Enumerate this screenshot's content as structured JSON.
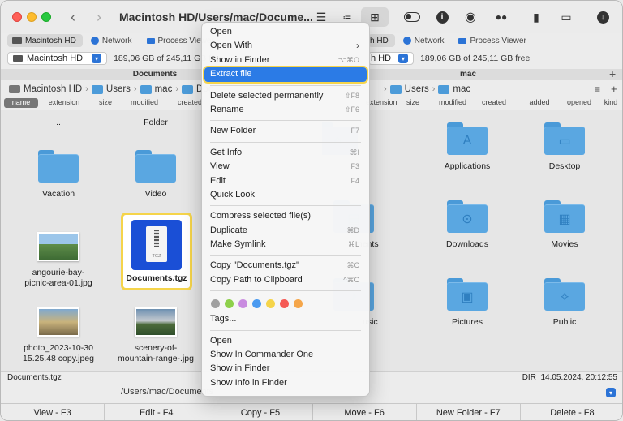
{
  "window": {
    "title": "Macintosh HD/Users/mac/Docume...",
    "traffic_lights": {
      "red": "#ff5f57",
      "yellow": "#febc2e",
      "green": "#28c840"
    }
  },
  "toolbar_icons": [
    "back-icon",
    "forward-icon",
    "list-icon",
    "detail-list-icon",
    "grid-icon",
    "toggle-icon",
    "info-icon",
    "eye-icon",
    "binoculars-icon",
    "zip-icon",
    "monitor-icon",
    "download-icon"
  ],
  "tabs_left": [
    {
      "label": "Macintosh HD",
      "icon": "hd-icon"
    },
    {
      "label": "Network",
      "icon": "globe-icon"
    },
    {
      "label": "Process Viewer",
      "icon": "process-icon"
    }
  ],
  "tabs_right": [
    {
      "label": "h HD",
      "icon": "hd-icon"
    },
    {
      "label": "Network",
      "icon": "globe-icon"
    },
    {
      "label": "Process Viewer",
      "icon": "process-icon"
    }
  ],
  "left_panel": {
    "drive": "Macintosh HD",
    "free": "189,06 GB of 245,11 GB free",
    "header": "Documents",
    "path": [
      "Macintosh HD",
      "Users",
      "mac",
      "Doc"
    ],
    "columns": [
      "name",
      "extension",
      "size",
      "modified",
      "created"
    ],
    "items": [
      {
        "name": "..",
        "kind": "up"
      },
      {
        "name": "Folder",
        "kind": "folder"
      },
      {
        "name": "Vacation",
        "kind": "folder"
      },
      {
        "name": "Video",
        "kind": "folder"
      },
      {
        "name": "angourie-bay-picnic-area-01.jpg",
        "kind": "photo"
      },
      {
        "name": "Documents.tgz",
        "kind": "archive",
        "badge": "TGZ"
      },
      {
        "name": "photo_2023-10-30 15.25.48 copy.jpeg",
        "kind": "photo"
      },
      {
        "name": "scenery-of-mountain-range-.jpg",
        "kind": "photo"
      }
    ]
  },
  "right_panel": {
    "drive": "h HD",
    "free": "189,06 GB of 245,11 GB free",
    "header": "mac",
    "path": [
      "Macintosh HD",
      "Users",
      "mac"
    ],
    "columns": [
      "extension",
      "size",
      "modified",
      "created",
      "added",
      "opened",
      "kind"
    ],
    "items": [
      {
        "name": "",
        "kind": "folder",
        "icon": "home-icon"
      },
      {
        "name": "Applications",
        "kind": "folder",
        "icon": "apps-icon"
      },
      {
        "name": "Desktop",
        "kind": "folder",
        "icon": "desktop-icon"
      },
      {
        "name": "ments",
        "kind": "folder",
        "icon": "doc-icon"
      },
      {
        "name": "Downloads",
        "kind": "folder",
        "icon": "download-icon"
      },
      {
        "name": "Movies",
        "kind": "folder",
        "icon": "film-icon"
      },
      {
        "name": "usic",
        "kind": "folder",
        "icon": "music-icon"
      },
      {
        "name": "Pictures",
        "kind": "folder",
        "icon": "picture-icon"
      },
      {
        "name": "Public",
        "kind": "folder",
        "icon": "public-icon"
      }
    ]
  },
  "status": {
    "left": "Documents.tgz",
    "right": "DIR  14.05.2024, 20:12:55"
  },
  "command_line": "/Users/mac/Documents",
  "function_keys": [
    "View - F3",
    "Edit - F4",
    "Copy - F5",
    "Move - F6",
    "New Folder - F7",
    "Delete - F8"
  ],
  "context_menu": {
    "groups": [
      [
        {
          "label": "Open",
          "shortcut": ""
        },
        {
          "label": "Open With",
          "shortcut": "›"
        },
        {
          "label": "Show in Finder",
          "shortcut": "⌥⌘O"
        },
        {
          "label": "Extract file",
          "shortcut": "",
          "highlighted": true
        }
      ],
      [
        {
          "label": "Delete selected permanently",
          "shortcut": "⇧F8"
        },
        {
          "label": "Rename",
          "shortcut": "⇧F6"
        }
      ],
      [
        {
          "label": "New Folder",
          "shortcut": "F7"
        }
      ],
      [
        {
          "label": "Get Info",
          "shortcut": "⌘I"
        },
        {
          "label": "View",
          "shortcut": "F3"
        },
        {
          "label": "Edit",
          "shortcut": "F4"
        },
        {
          "label": "Quick Look",
          "shortcut": ""
        }
      ],
      [
        {
          "label": "Compress selected file(s)",
          "shortcut": ""
        },
        {
          "label": "Duplicate",
          "shortcut": "⌘D"
        },
        {
          "label": "Make Symlink",
          "shortcut": "⌘L"
        }
      ],
      [
        {
          "label": "Copy \"Documents.tgz\"",
          "shortcut": "⌘C"
        },
        {
          "label": "Copy Path to Clipboard",
          "shortcut": "^⌘C"
        }
      ]
    ],
    "tag_colors": [
      "#a0a0a0",
      "#8ed04b",
      "#c98be0",
      "#4a9af0",
      "#f5d44a",
      "#f55a55",
      "#f5a64a"
    ],
    "tags_label": "Tags...",
    "services": [
      {
        "label": "Open"
      },
      {
        "label": "Show In Commander One"
      },
      {
        "label": "Show in Finder"
      },
      {
        "label": "Show Info in Finder"
      }
    ]
  }
}
